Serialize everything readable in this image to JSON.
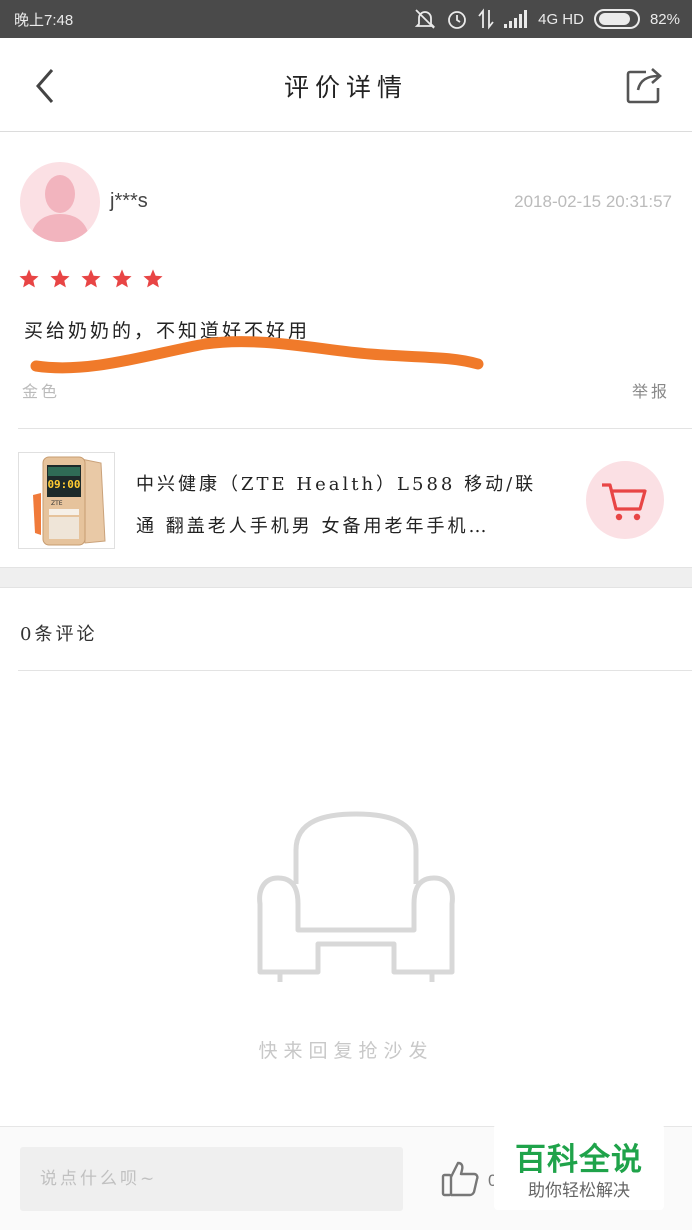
{
  "status_bar": {
    "time": "晚上7:48",
    "network": "4G HD",
    "battery": "82%",
    "battery_level": 0.82
  },
  "header": {
    "title": "评价详情",
    "back_icon": "chevron-left-icon",
    "share_icon": "share-icon"
  },
  "review": {
    "username": "j***s",
    "date": "2018-02-15 20:31:57",
    "rating": 5,
    "rating_max": 5,
    "text": "买给奶奶的，不知道好不好用",
    "variant": "金色",
    "report_label": "举报"
  },
  "product": {
    "name_line1": "中兴健康（ZTE Health）L588 移动/联",
    "name_line2": "通 翻盖老人手机男 女备用老年手机…",
    "screen_time": "09:00",
    "brand": "ZTE"
  },
  "comments": {
    "count_label": "0条评论",
    "empty_text": "快来回复抢沙发"
  },
  "bottom_bar": {
    "input_placeholder": "说点什么呗~",
    "like_count": "0"
  },
  "watermark": {
    "title": "百科全说",
    "subtitle": "助你轻松解决"
  },
  "colors": {
    "accent_red": "#e84545",
    "scribble_orange": "#f07a2a",
    "watermark_green": "#1fa34a"
  }
}
